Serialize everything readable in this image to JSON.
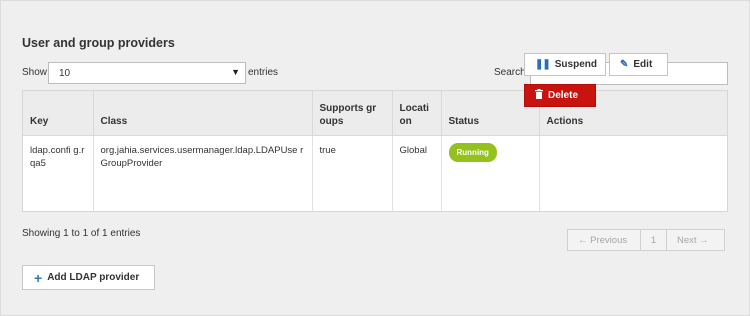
{
  "section": {
    "title": "User and group providers"
  },
  "length_control": {
    "show_label": "Show",
    "selected": "10",
    "entries_label": "entries"
  },
  "search": {
    "label": "Search:",
    "value": "",
    "placeholder": ""
  },
  "table": {
    "headers": [
      "Key",
      "Class",
      "Supports groups",
      "Location",
      "Status",
      "Actions"
    ],
    "header_display": {
      "supports_groups": "Supports gr oups",
      "location": "Locati on"
    },
    "rows": [
      {
        "key": "ldap.confi g.rqa5",
        "class": "org.jahia.services.usermanager.ldap.LDAPUse rGroupProvider",
        "supports_groups": "true",
        "location": "Global",
        "status": "Running",
        "actions": {
          "suspend": "Suspend",
          "edit": "Edit",
          "delete": "Delete"
        }
      }
    ]
  },
  "footer": {
    "info": "Showing 1 to 1 of 1 entries",
    "pagination": {
      "previous": "← Previous",
      "page": "1",
      "next": "Next →"
    }
  },
  "add_button": {
    "label": "Add LDAP provider"
  },
  "colors": {
    "status_running": "#95c11f",
    "delete_button": "#c9130f",
    "icon_blue": "#2a6ebb"
  },
  "icons": [
    "caret-down-icon",
    "pause-icon",
    "pencil-icon",
    "trash-icon",
    "plus-icon"
  ]
}
